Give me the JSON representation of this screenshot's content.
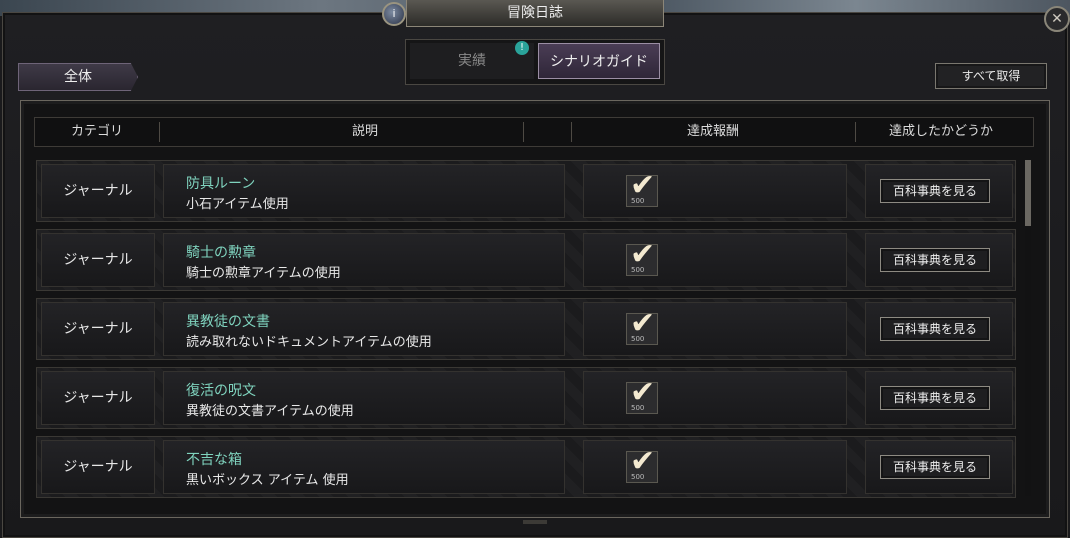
{
  "window": {
    "title": "冒険日誌"
  },
  "tabs": [
    {
      "label": "実績",
      "active": false
    },
    {
      "label": "シナリオガイド",
      "active": true
    }
  ],
  "tab_badge": "!",
  "filter": {
    "label": "全体"
  },
  "get_all_label": "すべて取得",
  "table": {
    "headers": [
      "カテゴリ",
      "説明",
      "達成報酬",
      "達成したかどうか"
    ],
    "rows": [
      {
        "category": "ジャーナル",
        "title": "防具ルーン",
        "desc": "小石アイテム使用",
        "reward_qty": "500",
        "action": "百科事典を見る"
      },
      {
        "category": "ジャーナル",
        "title": "騎士の勲章",
        "desc": "騎士の勲章アイテムの使用",
        "reward_qty": "500",
        "action": "百科事典を見る"
      },
      {
        "category": "ジャーナル",
        "title": "異教徒の文書",
        "desc": "読み取れないドキュメントアイテムの使用",
        "reward_qty": "500",
        "action": "百科事典を見る"
      },
      {
        "category": "ジャーナル",
        "title": "復活の呪文",
        "desc": "異教徒の文書アイテムの使用",
        "reward_qty": "500",
        "action": "百科事典を見る"
      },
      {
        "category": "ジャーナル",
        "title": "不吉な箱",
        "desc": "黒いボックス アイテム 使用",
        "reward_qty": "500",
        "action": "百科事典を見る"
      }
    ]
  },
  "scroll_position": 0.0,
  "colors": {
    "title_green": "#7fd3be",
    "active_tab": "#4a3d55",
    "badge": "#2aa39a"
  }
}
